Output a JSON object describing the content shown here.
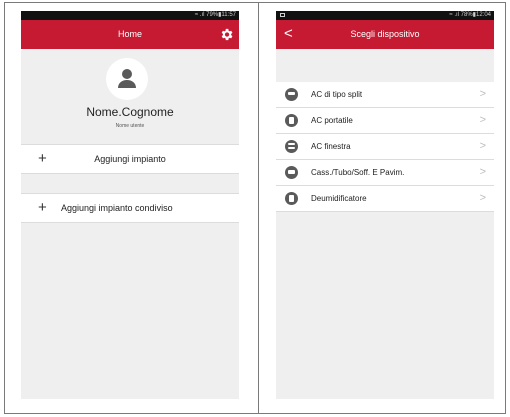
{
  "left_screen": {
    "status_text": "≈ .ıl 79%▮11:57",
    "title": "Home",
    "user_name": "Nome.Cognome",
    "user_caption": "Nome utente",
    "add_plant_label": "Aggiungi impianto",
    "add_shared_label": "Aggiungi impianto condiviso",
    "plus_glyph": "+"
  },
  "right_screen": {
    "status_text": "≈ .ıl 78%▮12:04",
    "title": "Scegli dispositivo",
    "back_glyph": "<",
    "devices": [
      {
        "label": "AC di tipo split",
        "icon": "split-ac-icon"
      },
      {
        "label": "AC portatile",
        "icon": "portable-ac-icon"
      },
      {
        "label": "AC finestra",
        "icon": "window-ac-icon"
      },
      {
        "label": "Cass./Tubo/Soff. E Pavim.",
        "icon": "cassette-ac-icon"
      },
      {
        "label": "Deumidificatore",
        "icon": "dehumidifier-icon"
      }
    ],
    "chevron_glyph": ">"
  },
  "colors": {
    "accent": "#c61a33",
    "background": "#efefef",
    "status_bar": "#111111",
    "icon_gray": "#5a5a5a"
  }
}
